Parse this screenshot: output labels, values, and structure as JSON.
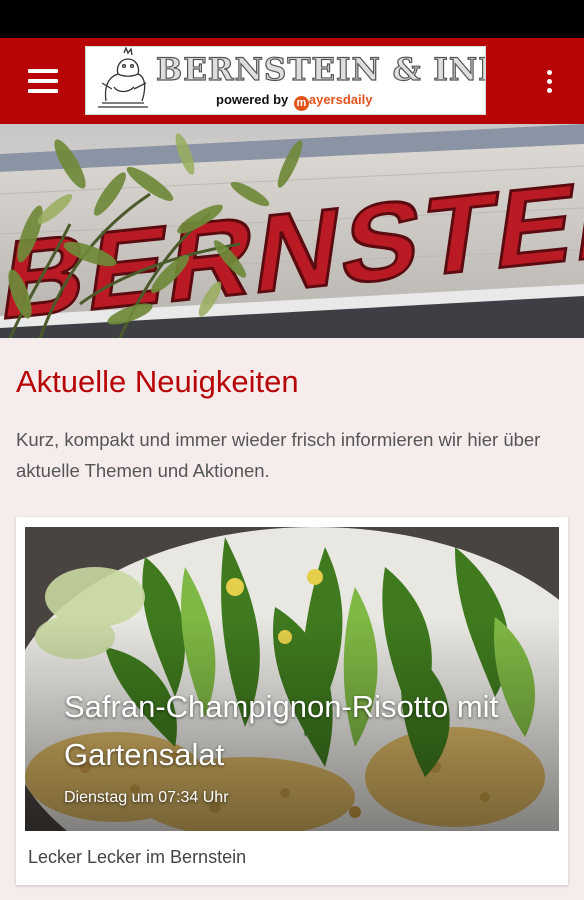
{
  "app_bar": {
    "logo_title": "BERNSTEIN & INBAR",
    "logo_powered_prefix": "powered by ",
    "logo_brand_m": "m",
    "logo_brand_rest": "ayersdaily",
    "menu_icon": "hamburger-menu-icon",
    "overflow_icon": "more-vertical-icon"
  },
  "hero": {
    "sign_text": "BERNSTEIN"
  },
  "news": {
    "title": "Aktuelle Neuigkeiten",
    "intro": "Kurz, kompakt und immer wieder frisch informieren wir hier über aktuelle Themen und Aktionen."
  },
  "cards": [
    {
      "title": "Safran-Champignon-Risotto mit Gartensalat",
      "date": "Dienstag um 07:34 Uhr",
      "caption": "Lecker Lecker im Bernstein"
    }
  ],
  "colors": {
    "brand_red": "#b70406",
    "background": "#f6ecec",
    "status_bar": "#000000",
    "mayersdaily_orange": "#e5541c"
  }
}
